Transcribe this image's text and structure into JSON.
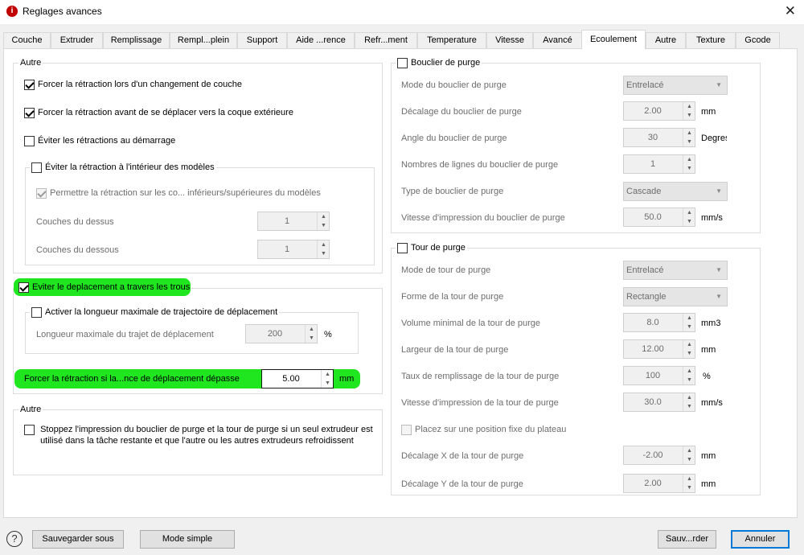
{
  "window": {
    "title": "Reglages avances",
    "close_glyph": "✕",
    "app_icon_glyph": "i"
  },
  "tabs": [
    {
      "label": "Couche"
    },
    {
      "label": "Extruder"
    },
    {
      "label": "Remplissage"
    },
    {
      "label": "Rempl...plein"
    },
    {
      "label": "Support"
    },
    {
      "label": "Aide ...rence"
    },
    {
      "label": "Refr...ment"
    },
    {
      "label": "Temperature"
    },
    {
      "label": "Vitesse"
    },
    {
      "label": "Avancé"
    },
    {
      "label": "Ecoulement",
      "active": true
    },
    {
      "label": "Autre"
    },
    {
      "label": "Texture"
    },
    {
      "label": "Gcode"
    }
  ],
  "left": {
    "autre1": {
      "title": "Autre",
      "force_layer_change": {
        "label": "Forcer la rétraction lors d'un changement de couche",
        "checked": true
      },
      "force_outer_shell": {
        "label": "Forcer la rétraction avant de se déplacer vers la coque extérieure",
        "checked": true
      },
      "avoid_start": {
        "label": "Éviter les rétractions au démarrage",
        "checked": false
      },
      "avoid_inside": {
        "label": "Éviter la rétraction à l'intérieur des modèles",
        "checked": false,
        "allow_top_bottom": {
          "label": "Permettre la rétraction sur les co... inférieurs/supérieures du modèles",
          "checked": true
        },
        "top_layers": {
          "label": "Couches du dessus",
          "value": "1"
        },
        "bottom_layers": {
          "label": "Couches du dessous",
          "value": "1"
        }
      }
    },
    "avoid_holes": {
      "label": "Eviter le deplacement a travers les trous",
      "checked": true,
      "max_length": {
        "label": "Activer la longueur maximale de trajectoire de déplacement",
        "checked": false,
        "field_label": "Longueur maximale du trajet de déplacement",
        "value": "200",
        "unit": "%"
      },
      "force_retract": {
        "label": "Forcer la rétraction si la...nce de déplacement dépasse",
        "value": "5.00",
        "unit": "mm"
      }
    },
    "autre2": {
      "title": "Autre",
      "stop_shield": {
        "line1": "Stoppez l'impression du bouclier de purge et la tour de purge si un seul extrudeur est",
        "line2": "utilisé dans la tâche restante et que l'autre ou les autres extrudeurs refroidissent",
        "checked": false
      }
    }
  },
  "right": {
    "shield": {
      "title": "Bouclier de purge",
      "checked": false,
      "mode": {
        "label": "Mode du bouclier de purge",
        "value": "Entrelacé"
      },
      "offset": {
        "label": "Décalage du bouclier de purge",
        "value": "2.00",
        "unit": "mm"
      },
      "angle": {
        "label": "Angle du bouclier de purge",
        "value": "30",
        "unit": "Degres"
      },
      "lines": {
        "label": "Nombres de lignes du bouclier de purge",
        "value": "1"
      },
      "type": {
        "label": "Type de bouclier de purge",
        "value": "Cascade"
      },
      "speed": {
        "label": "Vitesse d'impression du bouclier de purge",
        "value": "50.0",
        "unit": "mm/s"
      }
    },
    "tower": {
      "title": "Tour de purge",
      "checked": false,
      "mode": {
        "label": "Mode de tour de purge",
        "value": "Entrelacé"
      },
      "shape": {
        "label": "Forme de la tour de purge",
        "value": "Rectangle"
      },
      "volume": {
        "label": "Volume minimal de la tour de purge",
        "value": "8.0",
        "unit": "mm3"
      },
      "width": {
        "label": "Largeur de la tour de purge",
        "value": "12.00",
        "unit": "mm"
      },
      "fill": {
        "label": "Taux de remplissage de la tour de purge",
        "value": "100",
        "unit": "%"
      },
      "speed": {
        "label": "Vitesse d'impression de la tour de purge",
        "value": "30.0",
        "unit": "mm/s"
      },
      "fixed_pos": {
        "label": "Placez sur une position fixe du plateau",
        "checked": false
      },
      "offset_x": {
        "label": "Décalage X de la tour de purge",
        "value": "-2.00",
        "unit": "mm"
      },
      "offset_y": {
        "label": "Décalage Y de la tour de purge",
        "value": "2.00",
        "unit": "mm"
      }
    }
  },
  "footer": {
    "help_glyph": "?",
    "save_as": "Sauvegarder sous",
    "simple_mode": "Mode simple",
    "save": "Sauv...rder",
    "cancel": "Annuler"
  },
  "arrows": {
    "up": "▲",
    "down": "▼"
  },
  "colors": {
    "highlight": "#1fe61f",
    "default_button_border": "#0078d7",
    "app_icon": "#c00000"
  }
}
